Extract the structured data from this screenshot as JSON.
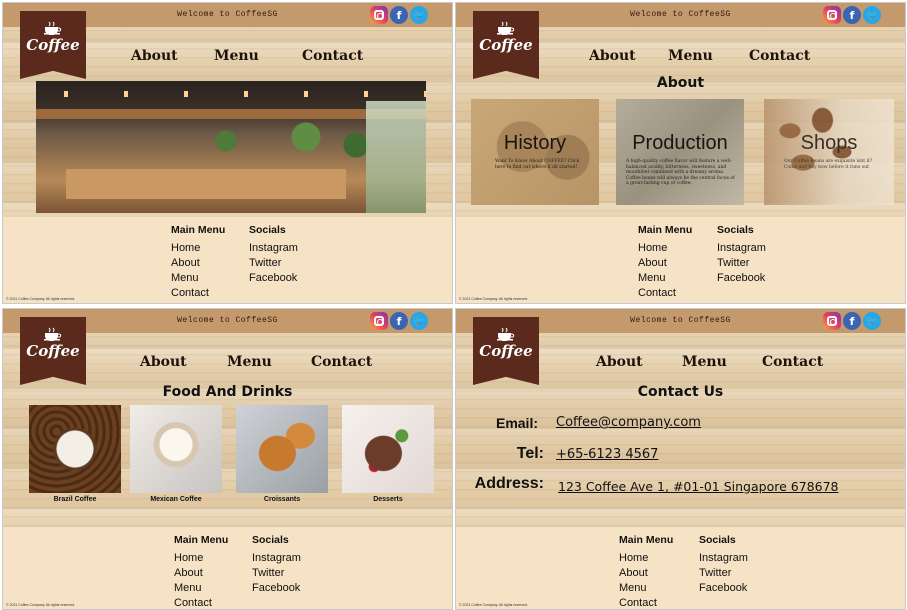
{
  "header": {
    "welcome": "Welcome to CoffeeSG",
    "brand": "Coffee",
    "icons": [
      "instagram-icon",
      "facebook-icon",
      "twitter-icon"
    ]
  },
  "nav": {
    "about": "About",
    "menu": "Menu",
    "contact": "Contact"
  },
  "footer": {
    "main_menu_title": "Main Menu",
    "main_menu": [
      "Home",
      "About",
      "Menu",
      "Contact"
    ],
    "socials_title": "Socials",
    "socials": [
      "Instagram",
      "Twitter",
      "Facebook"
    ],
    "copyright": "© 2021 Coffee Company. All rights reserved."
  },
  "about": {
    "title": "About",
    "cards": [
      {
        "title": "History",
        "desc": "Want To Know About COFFEE? Click here to find out where it all started!"
      },
      {
        "title": "Production",
        "desc": "A high-quality coffee flavor will feature a well-balanced acidity, bitterness, sweetness, and mouthfeel combined with a dreamy aroma. Coffee beans will always be the central focus of a great-tasting cup of coffee."
      },
      {
        "title": "Shops",
        "desc": "Our Coffee Beans are exquisite isnt it? Come and buy now before it runs out"
      }
    ]
  },
  "food": {
    "title": "Food And Drinks",
    "items": [
      "Brazil Coffee",
      "Mexican Coffee",
      "Croissants",
      "Desserts"
    ]
  },
  "contact": {
    "title": "Contact Us",
    "email_label": "Email:",
    "email": "Coffee@company.com",
    "tel_label": "Tel:",
    "tel": "+65-6123 4567",
    "address_label": "Address:",
    "address": "123 Coffee Ave 1, #01-01 Singapore 678678"
  },
  "colors": {
    "topbar": "#c49a6c",
    "logo": "#5b2a1d",
    "footer": "#f6e2c4"
  }
}
